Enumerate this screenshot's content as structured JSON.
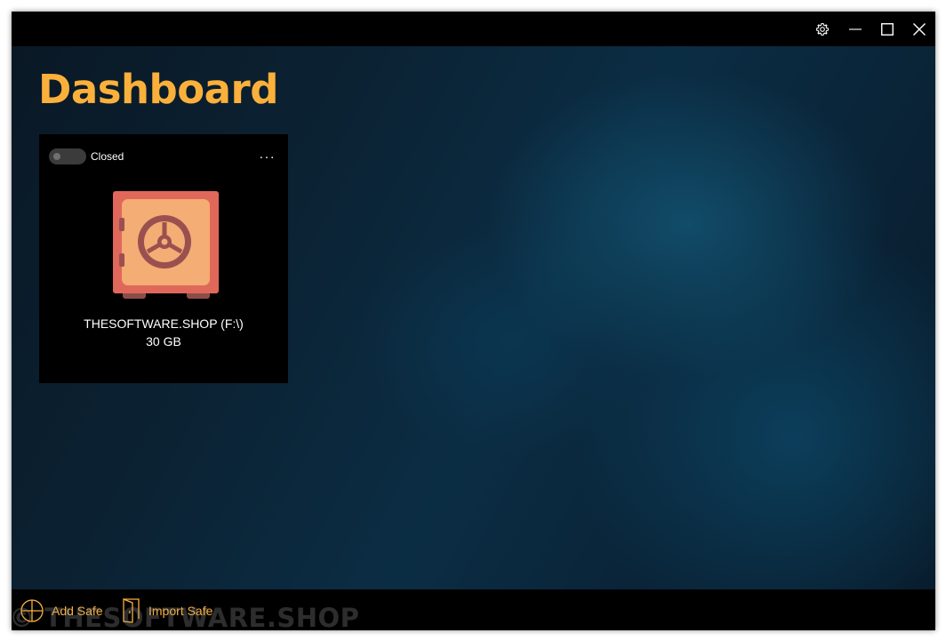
{
  "window": {
    "controls": {
      "settings_icon": "gear-icon",
      "minimize_icon": "minimize-icon",
      "maximize_icon": "maximize-icon",
      "close_icon": "close-icon"
    }
  },
  "dashboard": {
    "title": "Dashboard",
    "safes": [
      {
        "status_label": "Closed",
        "is_open": false,
        "more_label": "...",
        "icon": "safe-icon",
        "name": "THESOFTWARE.SHOP (F:\\)",
        "size": "30 GB"
      }
    ]
  },
  "bottom_bar": {
    "add_safe": {
      "label": "Add Safe",
      "icon": "plus-circle-icon"
    },
    "import_safe": {
      "label": "Import Safe",
      "icon": "import-door-icon"
    }
  },
  "watermark": "© THESOFTWARE.SHOP",
  "colors": {
    "accent": "#fbb03b",
    "safe_body": "#e0685a",
    "safe_door": "#f4ad74",
    "safe_dial": "#9b5050",
    "background_dark": "#000000",
    "background_blue": "#0b2d44"
  }
}
